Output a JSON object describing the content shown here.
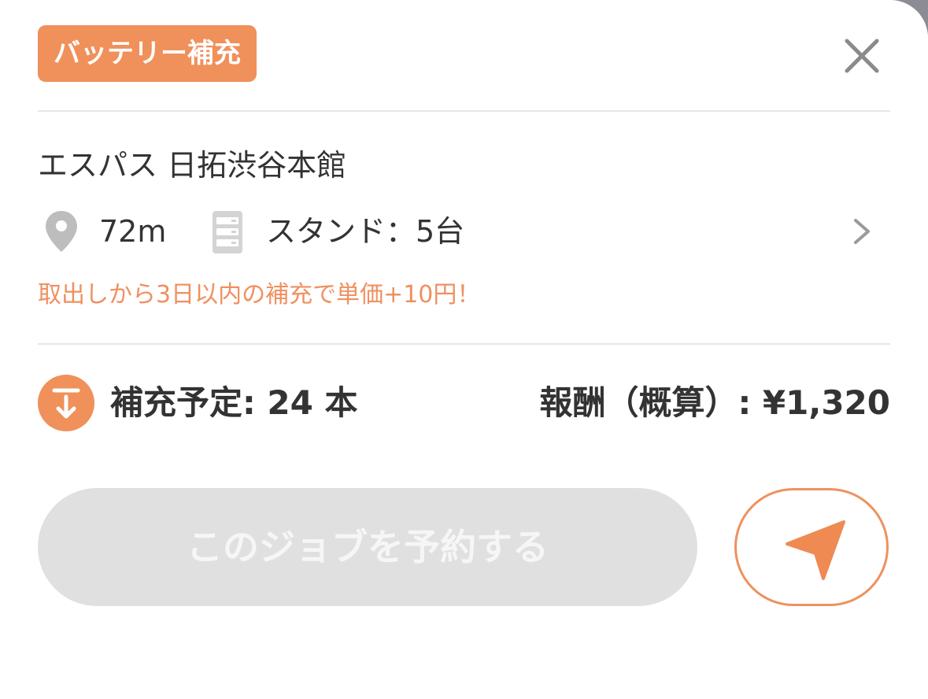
{
  "header": {
    "badge_label": "バッテリー補充",
    "close_icon": "close-icon"
  },
  "station": {
    "name": "エスパス 日拓渋谷本館",
    "distance": "72m",
    "stand_count": "スタンド：5台",
    "bonus_note": "取出しから3日以内の補充で単価+10円！"
  },
  "summary": {
    "plan_label": "補充予定: 24 本",
    "reward_label": "報酬（概算）: ¥1,320"
  },
  "actions": {
    "reserve_label": "このジョブを予約する",
    "navigate_icon": "navigation-arrow-icon"
  },
  "colors": {
    "accent": "#F0905A",
    "text": "#333333",
    "disabled_button": "#E0E0E0",
    "divider": "#E6E6E6",
    "icon_gray": "#BDBDBD"
  }
}
